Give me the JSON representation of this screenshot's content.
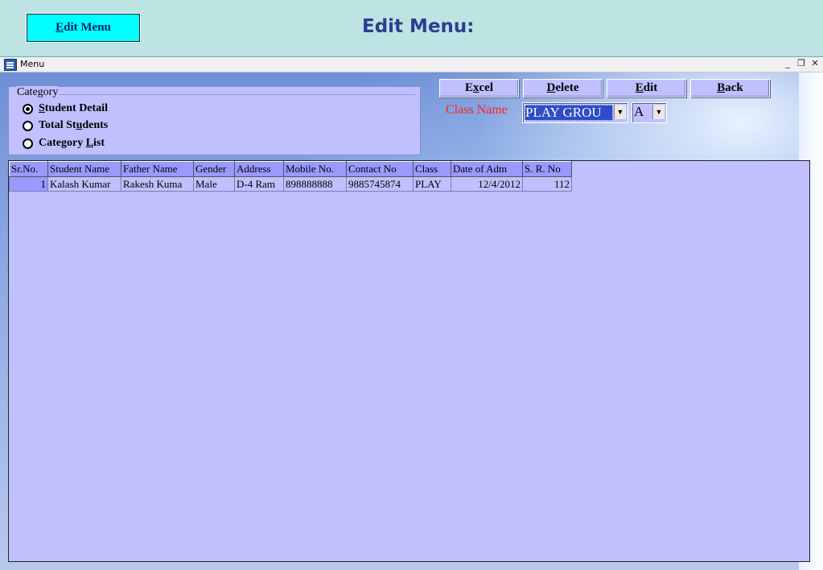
{
  "header": {
    "button_label": "Edit Menu",
    "button_accel": "E",
    "button_rest": "dit Menu",
    "title": "Edit Menu:"
  },
  "window": {
    "title": "Menu",
    "minimize": "_",
    "restore": "❐",
    "close": "✕"
  },
  "category": {
    "legend": "Category",
    "options": [
      {
        "pre": "",
        "accel": "S",
        "post": "tudent Detail",
        "checked": true
      },
      {
        "pre": "Total St",
        "accel": "u",
        "post": "dents",
        "checked": false
      },
      {
        "pre": "Category ",
        "accel": "L",
        "post": "ist",
        "checked": false
      }
    ]
  },
  "buttons": [
    {
      "pre": "E",
      "accel": "x",
      "post": "cel"
    },
    {
      "pre": "",
      "accel": "D",
      "post": "elete"
    },
    {
      "pre": "",
      "accel": "E",
      "post": "dit"
    },
    {
      "pre": "",
      "accel": "B",
      "post": "ack"
    }
  ],
  "class_filter": {
    "label": "Class Name",
    "class_value": "PLAY GROU",
    "section_value": "A"
  },
  "grid": {
    "columns": [
      "Sr.No.",
      "Student Name",
      "Father Name",
      "Gender",
      "Address",
      "Mobile No.",
      "Contact  No",
      "Class",
      "Date of Adm",
      "S. R. No"
    ],
    "rows": [
      [
        "1",
        "Kalash Kumar",
        "Rakesh Kuma",
        "Male",
        "D-4 Ram",
        "898888888",
        "9885745874",
        "PLAY",
        "12/4/2012",
        "112"
      ]
    ]
  }
}
